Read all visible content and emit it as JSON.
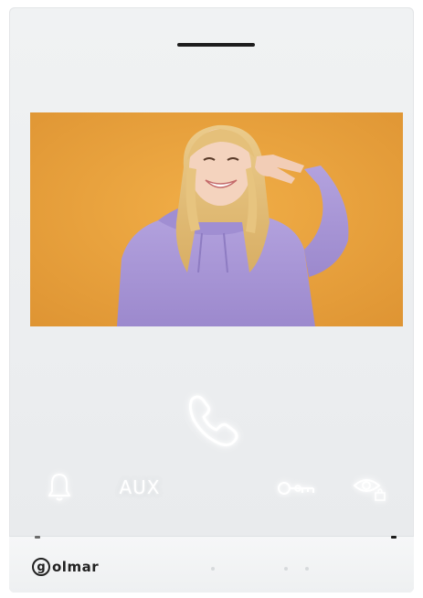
{
  "device": {
    "brand": "golmar",
    "brand_initial": "g",
    "screen": {
      "content": "video-feed",
      "background_color": "#E9A13B",
      "hoodie_color": "#A996D6",
      "hair_color": "#E6C27F"
    },
    "buttons": {
      "call": {
        "icon": "phone-handset-icon"
      },
      "bell": {
        "icon": "bell-icon"
      },
      "aux": {
        "label": "AUX"
      },
      "door": {
        "icon": "key-icon"
      },
      "monitor": {
        "icon": "eye-camera-icon"
      }
    },
    "colors": {
      "body": "#EEF0F1",
      "button_glow": "#FFFFFF",
      "logo": "#222222"
    }
  }
}
